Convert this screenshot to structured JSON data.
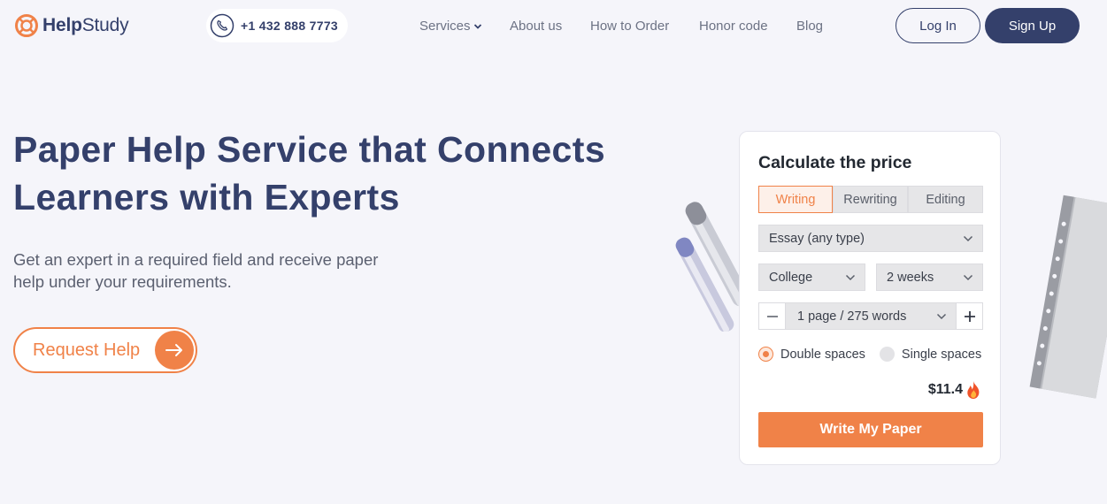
{
  "brand": {
    "name_bold": "Help",
    "name_regular": "Study",
    "accent": "#f08248",
    "primary": "#34406b"
  },
  "header": {
    "phone": "+1 432 888 7773",
    "nav": [
      {
        "label": "Services",
        "has_dropdown": true
      },
      {
        "label": "About us"
      },
      {
        "label": "How to Order"
      },
      {
        "label": "Honor code"
      },
      {
        "label": "Blog"
      }
    ],
    "login_label": "Log In",
    "signup_label": "Sign Up"
  },
  "hero": {
    "title": "Paper Help Service that Connects Learners with Experts",
    "subtitle": "Get an expert in a required field and receive paper help under your requirements.",
    "cta_label": "Request Help"
  },
  "calculator": {
    "title": "Calculate the price",
    "tabs": [
      {
        "label": "Writing",
        "active": true
      },
      {
        "label": "Rewriting",
        "active": false
      },
      {
        "label": "Editing",
        "active": false
      }
    ],
    "paper_type": "Essay (any type)",
    "level": "College",
    "deadline": "2 weeks",
    "pages": "1 page / 275 words",
    "spacing_options": [
      {
        "label": "Double spaces",
        "selected": true
      },
      {
        "label": "Single spaces",
        "selected": false
      }
    ],
    "price": "$11.4",
    "submit_label": "Write My Paper"
  },
  "icons": {
    "logo": "lifebuoy-icon",
    "phone": "phone-icon",
    "dropdown": "chevron-down-icon",
    "cta": "arrow-right-icon",
    "minus": "minus-icon",
    "plus": "plus-icon",
    "hot": "fire-icon"
  }
}
